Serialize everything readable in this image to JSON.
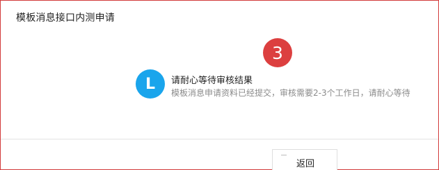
{
  "dialog": {
    "title": "模板消息接口内测申请"
  },
  "step": {
    "number": "3"
  },
  "status": {
    "avatar_letter": "L",
    "title": "请耐心等待审核结果",
    "description": "模板消息申请资料已经提交，审核需要2-3个工作日，请耐心等待"
  },
  "footer": {
    "back_label": "返回"
  },
  "colors": {
    "frame_border": "#d23a3a",
    "step_badge": "#dc3f3f",
    "avatar": "#1aa5ec"
  }
}
